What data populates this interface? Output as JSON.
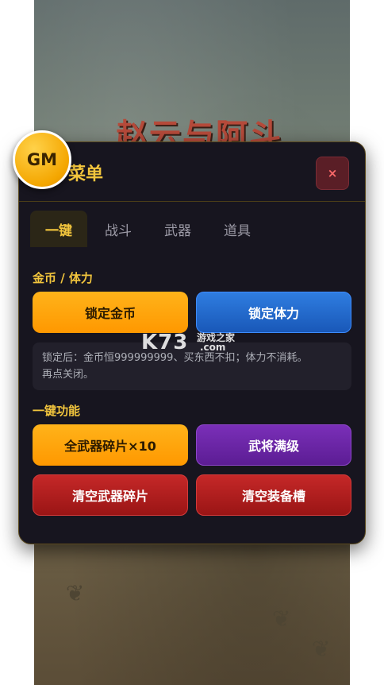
{
  "game": {
    "title": "赵云与阿斗"
  },
  "gm_badge": {
    "label": "GM"
  },
  "panel": {
    "title": "菜单",
    "close_label": "×"
  },
  "tabs": [
    {
      "label": "一键",
      "active": true
    },
    {
      "label": "战斗",
      "active": false
    },
    {
      "label": "武器",
      "active": false
    },
    {
      "label": "道具",
      "active": false
    }
  ],
  "section_currency": {
    "label": "金币 / 体力",
    "lock_gold": "锁定金币",
    "lock_stamina": "锁定体力",
    "note_line1": "锁定后：金币恒999999999、买东西不扣；体力不消耗。",
    "note_line2": "再点关闭。"
  },
  "section_oneclick": {
    "label": "一键功能",
    "all_weapon_fragments": "全武器碎片×10",
    "general_max_level": "武将满级",
    "clear_weapon_fragments": "清空武器碎片",
    "clear_equip_slots": "清空装备槽"
  },
  "watermark": {
    "main": "K73",
    "site": "游戏之家",
    "domain": ".com"
  },
  "colors": {
    "accent_gold": "#f2c53d",
    "panel_bg": "#17151f",
    "blue_button": "#1958b8",
    "purple_button": "#5c1d94",
    "red_button": "#9a1515"
  }
}
